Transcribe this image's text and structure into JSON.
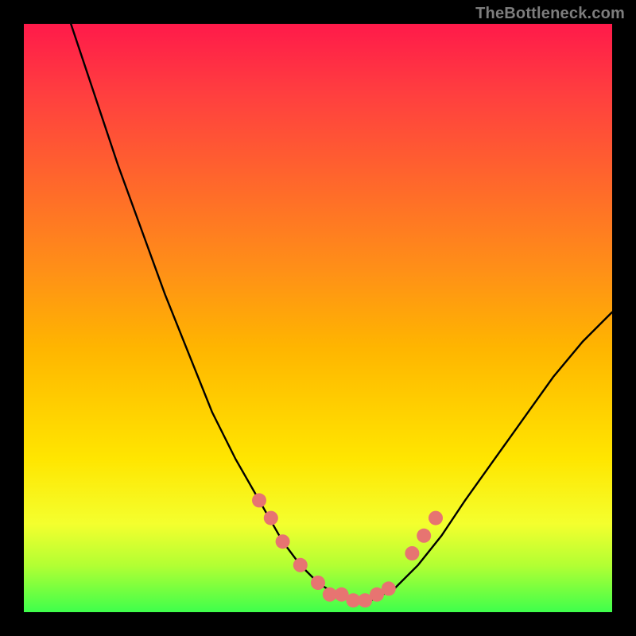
{
  "watermark": "TheBottleneck.com",
  "colors": {
    "bg": "#000000",
    "curve": "#000000",
    "dots": "#e77471",
    "gradient_stops": [
      "#ff1a4a",
      "#ff3f3f",
      "#ff6a2a",
      "#ff9017",
      "#ffb500",
      "#ffe600",
      "#f4ff2e",
      "#b3ff33",
      "#3eff4c"
    ]
  },
  "chart_data": {
    "type": "line",
    "title": "",
    "xlabel": "",
    "ylabel": "",
    "xlim": [
      0,
      100
    ],
    "ylim": [
      0,
      100
    ],
    "series": [
      {
        "name": "curve",
        "x": [
          8,
          12,
          16,
          20,
          24,
          28,
          32,
          36,
          40,
          44,
          47,
          50,
          53,
          56,
          59,
          63,
          67,
          71,
          75,
          80,
          85,
          90,
          95,
          100
        ],
        "y": [
          100,
          88,
          76,
          65,
          54,
          44,
          34,
          26,
          19,
          12,
          8,
          5,
          3,
          2,
          2,
          4,
          8,
          13,
          19,
          26,
          33,
          40,
          46,
          51
        ]
      }
    ],
    "markers": {
      "name": "highlight-dots",
      "x": [
        40,
        42,
        44,
        47,
        50,
        52,
        54,
        56,
        58,
        60,
        62,
        66,
        68,
        70
      ],
      "y": [
        19,
        16,
        12,
        8,
        5,
        3,
        3,
        2,
        2,
        3,
        4,
        10,
        13,
        16
      ]
    }
  }
}
